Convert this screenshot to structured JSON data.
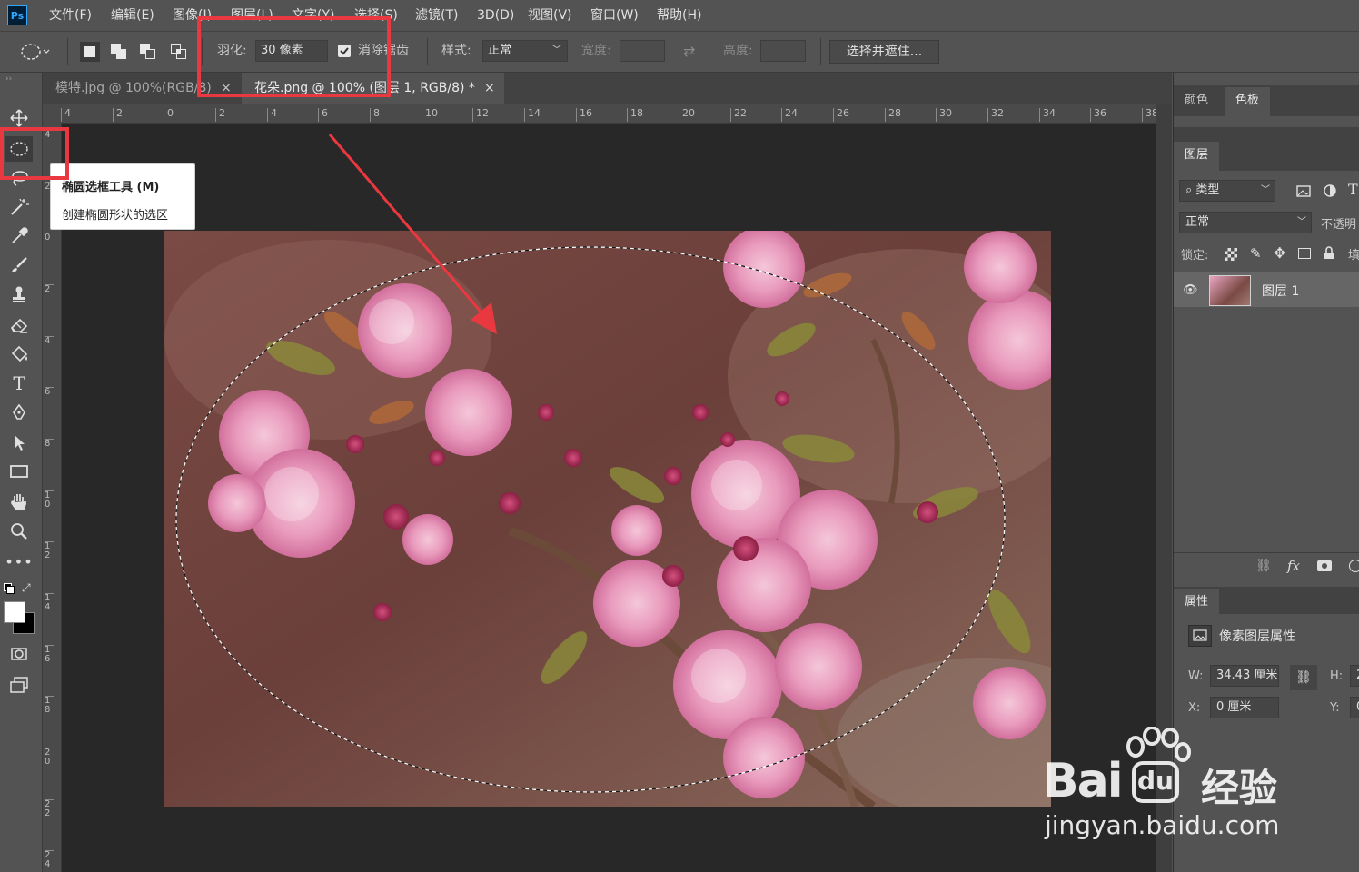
{
  "app": {
    "logo_text": "Ps"
  },
  "menubar": {
    "items": [
      "文件(F)",
      "编辑(E)",
      "图像(I)",
      "图层(L)",
      "文字(Y)",
      "选择(S)",
      "滤镜(T)",
      "3D(D)",
      "视图(V)",
      "窗口(W)",
      "帮助(H)"
    ]
  },
  "options": {
    "feather_label": "羽化:",
    "feather_value": "30 像素",
    "antialias_label": "消除锯齿",
    "antialias_checked": true,
    "style_label": "样式:",
    "style_value": "正常",
    "width_label": "宽度:",
    "height_label": "高度:",
    "select_mask_button": "选择并遮住..."
  },
  "tabs": [
    {
      "label": "模特.jpg @ 100%(RGB/8)",
      "close": "×",
      "active": false
    },
    {
      "label": "花朵.png @ 100% (图层 1, RGB/8) *",
      "close": "×",
      "active": true
    }
  ],
  "ruler": {
    "h_labels": [
      "4",
      "2",
      "0",
      "2",
      "4",
      "6",
      "8",
      "10",
      "12",
      "14",
      "16",
      "18",
      "20",
      "22",
      "24",
      "26",
      "28",
      "30",
      "32",
      "34",
      "36",
      "38"
    ],
    "v_labels": [
      "4",
      "2",
      "0",
      "2",
      "4",
      "6",
      "8",
      "10",
      "12",
      "14",
      "16",
      "18",
      "20",
      "22",
      "24"
    ]
  },
  "tooltip": {
    "title": "椭圆选框工具 (M)",
    "description": "创建椭圆形状的选区"
  },
  "panels": {
    "color_tabs": [
      "颜色",
      "色板"
    ],
    "layers_tab": "图层",
    "filter_label": "类型",
    "blend_mode": "正常",
    "opacity_label": "不透明",
    "lock_label": "锁定:",
    "fill_label": "填",
    "layer_name": "图层 1",
    "properties_tab": "属性",
    "properties_title": "像素图层属性",
    "w_label": "W:",
    "w_value": "34.43 厘米",
    "h_label": "H:",
    "h_value": "2",
    "x_label": "X:",
    "x_value": "0 厘米",
    "y_label": "Y:",
    "y_value": "0"
  },
  "watermark": {
    "brand": "Bai",
    "brand2": "经验",
    "url": "jingyan.baidu.com"
  },
  "colors": {
    "highlight": "#e9383f",
    "ui_bg": "#535353",
    "canvas_bg": "#282828"
  }
}
